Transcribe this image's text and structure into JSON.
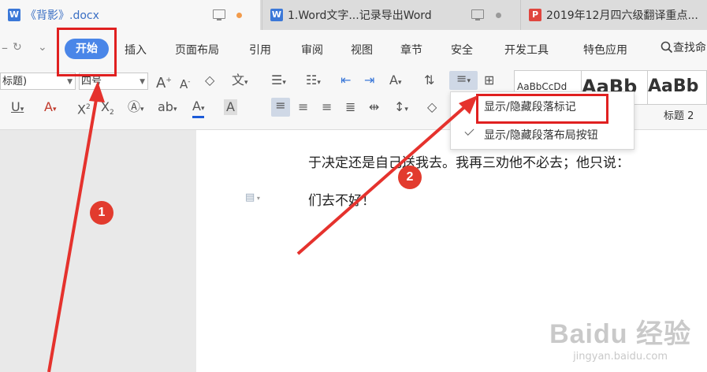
{
  "tabs": [
    {
      "title": "《背影》.docx",
      "icon": "W"
    },
    {
      "title": "1.Word文字...记录导出Word",
      "icon": "W"
    },
    {
      "title": "2019年12月四六级翻译重点...",
      "icon": "P"
    }
  ],
  "quick_access": {
    "redo": "↻",
    "more": "⌄"
  },
  "menu": {
    "start": "开始",
    "items": [
      "插入",
      "页面布局",
      "引用",
      "审阅",
      "视图",
      "章节",
      "安全",
      "开发工具",
      "特色应用"
    ],
    "search": "查找命"
  },
  "ribbon": {
    "style_combo": "标题)",
    "font_size_combo": "四号",
    "style_previews": [
      "AaBbCcDd",
      "AaBb",
      "AaBb"
    ],
    "style_names": [
      "标题 2"
    ]
  },
  "dropdown": {
    "items": [
      "显示/隐藏段落标记",
      "显示/隐藏段落布局按钮"
    ]
  },
  "document": {
    "line1": "于决定还是自己送我去。我再三劝他不必去；他只说：",
    "line2": "们去不好！"
  },
  "annotations": {
    "badge1": "1",
    "badge2": "2"
  },
  "watermark": {
    "brand": "Baidu 经验",
    "url": "jingyan.baidu.com"
  },
  "colors": {
    "accent": "#4a86e8",
    "annotation_red": "#e02020"
  }
}
